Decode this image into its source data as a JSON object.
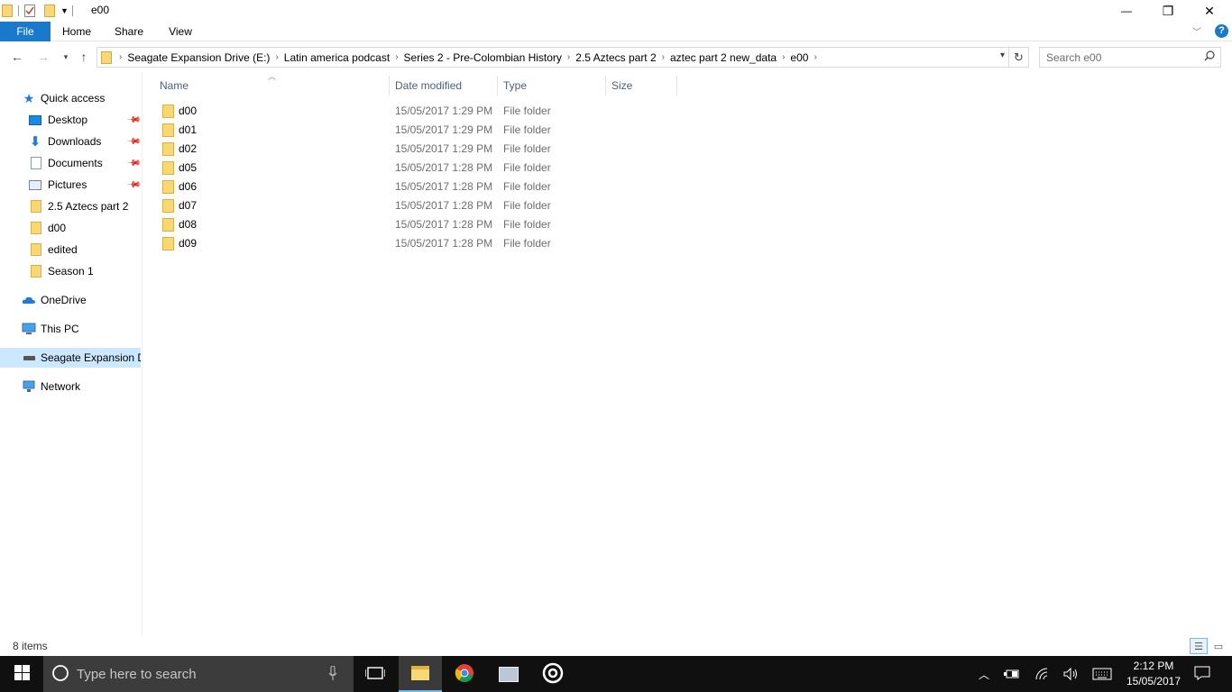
{
  "window": {
    "title": "e00",
    "controls": {
      "minimize": "—",
      "restore": "❐",
      "close": "✕"
    }
  },
  "ribbon": {
    "tabs": [
      {
        "label": "File"
      },
      {
        "label": "Home"
      },
      {
        "label": "Share"
      },
      {
        "label": "View"
      }
    ],
    "expand_icon": "chevron-down-icon",
    "help_icon": "help-icon"
  },
  "address_bar": {
    "breadcrumbs": [
      "Seagate Expansion Drive (E:)",
      "Latin america podcast",
      "Series 2 - Pre-Colombian History",
      "2.5 Aztecs part 2",
      "aztec part 2 new_data",
      "e00"
    ]
  },
  "search": {
    "placeholder": "Search e00"
  },
  "sidebar": {
    "items": [
      {
        "label": "Quick access",
        "icon": "star-icon"
      },
      {
        "label": "Desktop",
        "icon": "desktop-icon",
        "pinned": true
      },
      {
        "label": "Downloads",
        "icon": "download-icon",
        "pinned": true
      },
      {
        "label": "Documents",
        "icon": "documents-icon",
        "pinned": true
      },
      {
        "label": "Pictures",
        "icon": "pictures-icon",
        "pinned": true
      },
      {
        "label": "2.5 Aztecs part 2",
        "icon": "folder-icon"
      },
      {
        "label": "d00",
        "icon": "folder-icon"
      },
      {
        "label": "edited",
        "icon": "folder-icon"
      },
      {
        "label": "Season 1",
        "icon": "folder-icon"
      },
      {
        "label": "OneDrive",
        "icon": "cloud-icon"
      },
      {
        "label": "This PC",
        "icon": "computer-icon"
      },
      {
        "label": "Seagate Expansion Dr",
        "icon": "drive-icon",
        "selected": true
      },
      {
        "label": "Network",
        "icon": "network-icon"
      }
    ]
  },
  "columns": [
    "Name",
    "Date modified",
    "Type",
    "Size"
  ],
  "files": [
    {
      "name": "d00",
      "date": "15/05/2017 1:29 PM",
      "type": "File folder",
      "size": ""
    },
    {
      "name": "d01",
      "date": "15/05/2017 1:29 PM",
      "type": "File folder",
      "size": ""
    },
    {
      "name": "d02",
      "date": "15/05/2017 1:29 PM",
      "type": "File folder",
      "size": ""
    },
    {
      "name": "d05",
      "date": "15/05/2017 1:28 PM",
      "type": "File folder",
      "size": ""
    },
    {
      "name": "d06",
      "date": "15/05/2017 1:28 PM",
      "type": "File folder",
      "size": ""
    },
    {
      "name": "d07",
      "date": "15/05/2017 1:28 PM",
      "type": "File folder",
      "size": ""
    },
    {
      "name": "d08",
      "date": "15/05/2017 1:28 PM",
      "type": "File folder",
      "size": ""
    },
    {
      "name": "d09",
      "date": "15/05/2017 1:28 PM",
      "type": "File folder",
      "size": ""
    }
  ],
  "status": {
    "item_count": "8 items"
  },
  "taskbar": {
    "search_placeholder": "Type here to search",
    "time": "2:12 PM",
    "date": "15/05/2017"
  },
  "colors": {
    "file_tab": "#1979ca",
    "selection": "#cce8ff",
    "folder": "#f8d775",
    "taskbar": "#101010"
  }
}
